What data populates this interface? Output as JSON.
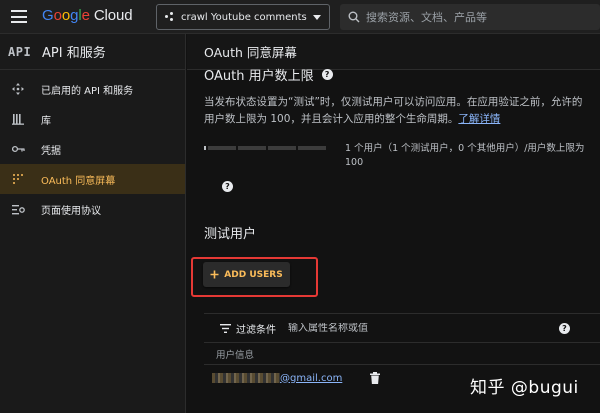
{
  "topbar": {
    "logo_letters": [
      "G",
      "o",
      "o",
      "g",
      "l",
      "e"
    ],
    "logo_suffix": "Cloud",
    "project_name": "crawl Youtube comments",
    "search_placeholder": "搜索资源、文档、产品等"
  },
  "sidebar": {
    "badge": "API",
    "title": "API 和服务",
    "items": [
      {
        "label": "已启用的 API 和服务",
        "icon": "move-arrows-icon"
      },
      {
        "label": "库",
        "icon": "library-icon"
      },
      {
        "label": "凭据",
        "icon": "key-icon"
      },
      {
        "label": "OAuth 同意屏幕",
        "icon": "consent-screen-icon",
        "active": true
      },
      {
        "label": "页面使用协议",
        "icon": "settings-list-icon"
      }
    ]
  },
  "main": {
    "header": "OAuth 同意屏幕",
    "section_title": "OAuth 用户数上限",
    "description": "当发布状态设置为“测试”时，仅测试用户可以访问应用。在应用验证之前，允许的用户数上限为 100，并且会计入应用的整个生命周期。",
    "learn_more": "了解详情",
    "user_cap_text": "1 个用户（1 个测试用户，0 个其他用户）/用户数上限为 100",
    "user_cap_fraction": 0.01,
    "test_users_title": "测试用户",
    "add_users_label": "ADD USERS",
    "filter_label": "过滤条件",
    "filter_placeholder": "输入属性名称或值",
    "column_header": "用户信息",
    "user_email_suffix": "@gmail.com"
  },
  "watermark": "知乎 @bugui",
  "colors": {
    "accent": "#fbbc5a",
    "link": "#8ab4f8",
    "highlight_box": "#e53935"
  }
}
